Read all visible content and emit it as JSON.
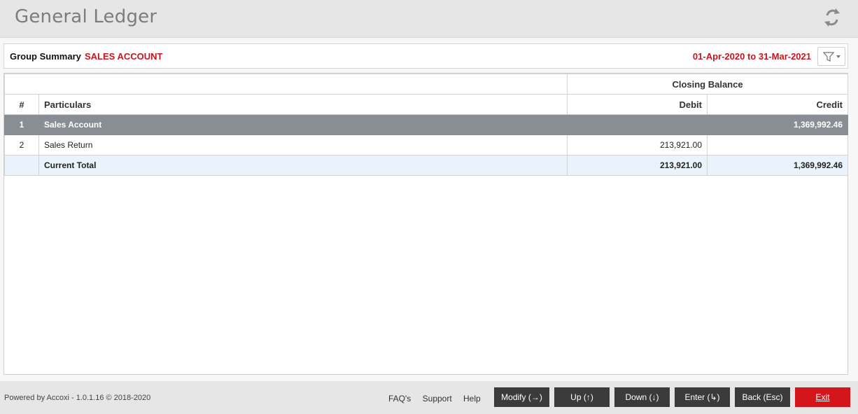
{
  "header": {
    "title": "General Ledger",
    "refresh_icon": "refresh-icon"
  },
  "summary": {
    "label": "Group Summary",
    "group_name": "SALES ACCOUNT",
    "period": "01-Apr-2020 to 31-Mar-2021",
    "filter_icon": "filter-icon"
  },
  "table": {
    "group_header": "Closing Balance",
    "columns": [
      "#",
      "Particulars",
      "Debit",
      "Credit"
    ],
    "rows": [
      {
        "num": "1",
        "particulars": "Sales Account",
        "debit": "",
        "credit": "1,369,992.46"
      },
      {
        "num": "2",
        "particulars": "Sales Return",
        "debit": "213,921.00",
        "credit": ""
      }
    ],
    "total": {
      "num": "",
      "particulars": "Current Total",
      "debit": "213,921.00",
      "credit": "1,369,992.46"
    }
  },
  "footer": {
    "powered": "Powered by Accoxi - 1.0.1.16 © 2018-2020",
    "links": [
      "FAQ's",
      "Support",
      "Help"
    ],
    "buttons": {
      "modify": "Modify (→)",
      "up": "Up (↑)",
      "down": "Down (↓)",
      "enter": "Enter (↳)",
      "back": "Back (Esc)",
      "exit": "Exit"
    }
  },
  "colors": {
    "accent_red": "#c9151c",
    "exit_button": "#d5151c",
    "dark_button": "#3b3b3b",
    "group_row": "#898e94",
    "total_row": "#eaf3fc"
  }
}
